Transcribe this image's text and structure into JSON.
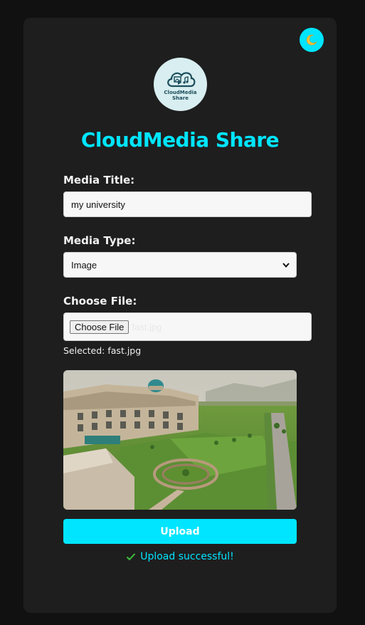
{
  "app": {
    "title": "CloudMedia Share",
    "logo_text": "CloudMedia Share",
    "accent_color": "#00e5ff"
  },
  "theme_toggle": {
    "icon": "moon-icon"
  },
  "form": {
    "title_label": "Media Title:",
    "title_value": "my university",
    "type_label": "Media Type:",
    "type_selected": "Image",
    "file_label": "Choose File:",
    "file_button": "Choose File",
    "file_name": "fast.jpg",
    "selected_text": "Selected: fast.jpg"
  },
  "preview": {
    "alt": "university campus"
  },
  "actions": {
    "upload_label": "Upload"
  },
  "status": {
    "message": "Upload successful!",
    "icon": "check-icon",
    "color": "#00e5ff"
  }
}
